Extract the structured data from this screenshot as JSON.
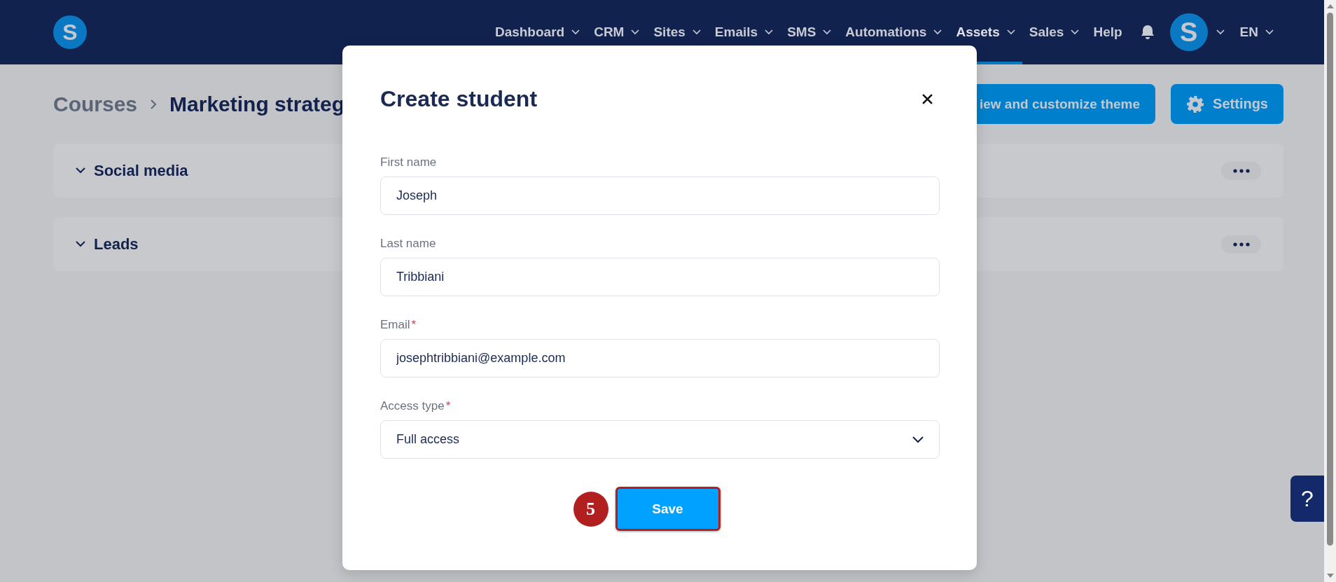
{
  "logo": "S",
  "nav": {
    "items": [
      {
        "label": "Dashboard",
        "dropdown": true,
        "selected": false
      },
      {
        "label": "CRM",
        "dropdown": true,
        "selected": false
      },
      {
        "label": "Sites",
        "dropdown": true,
        "selected": false
      },
      {
        "label": "Emails",
        "dropdown": true,
        "selected": false
      },
      {
        "label": "SMS",
        "dropdown": true,
        "selected": false
      },
      {
        "label": "Automations",
        "dropdown": true,
        "selected": false
      },
      {
        "label": "Assets",
        "dropdown": true,
        "selected": true
      },
      {
        "label": "Sales",
        "dropdown": true,
        "selected": false
      },
      {
        "label": "Help",
        "dropdown": false,
        "selected": false
      }
    ],
    "avatar": "S",
    "language": "EN"
  },
  "breadcrumb": [
    "Courses",
    "Marketing strateg"
  ],
  "header_buttons": {
    "theme": "iew and customize theme",
    "settings": "Settings"
  },
  "sections": [
    {
      "title": "Social media"
    },
    {
      "title": "Leads"
    }
  ],
  "modal": {
    "title": "Create student",
    "fields": [
      {
        "kind": "text",
        "label": "First name",
        "value": "Joseph"
      },
      {
        "kind": "text",
        "label": "Last name",
        "value": "Tribbiani"
      },
      {
        "kind": "text",
        "label": "Email",
        "required_mark": "*",
        "value": "josephtribbiani@example.com"
      },
      {
        "kind": "select",
        "label": "Access type",
        "required_mark": "*",
        "value": "Full access"
      }
    ],
    "save": "Save",
    "step_badge": "5"
  },
  "help_button": "?"
}
